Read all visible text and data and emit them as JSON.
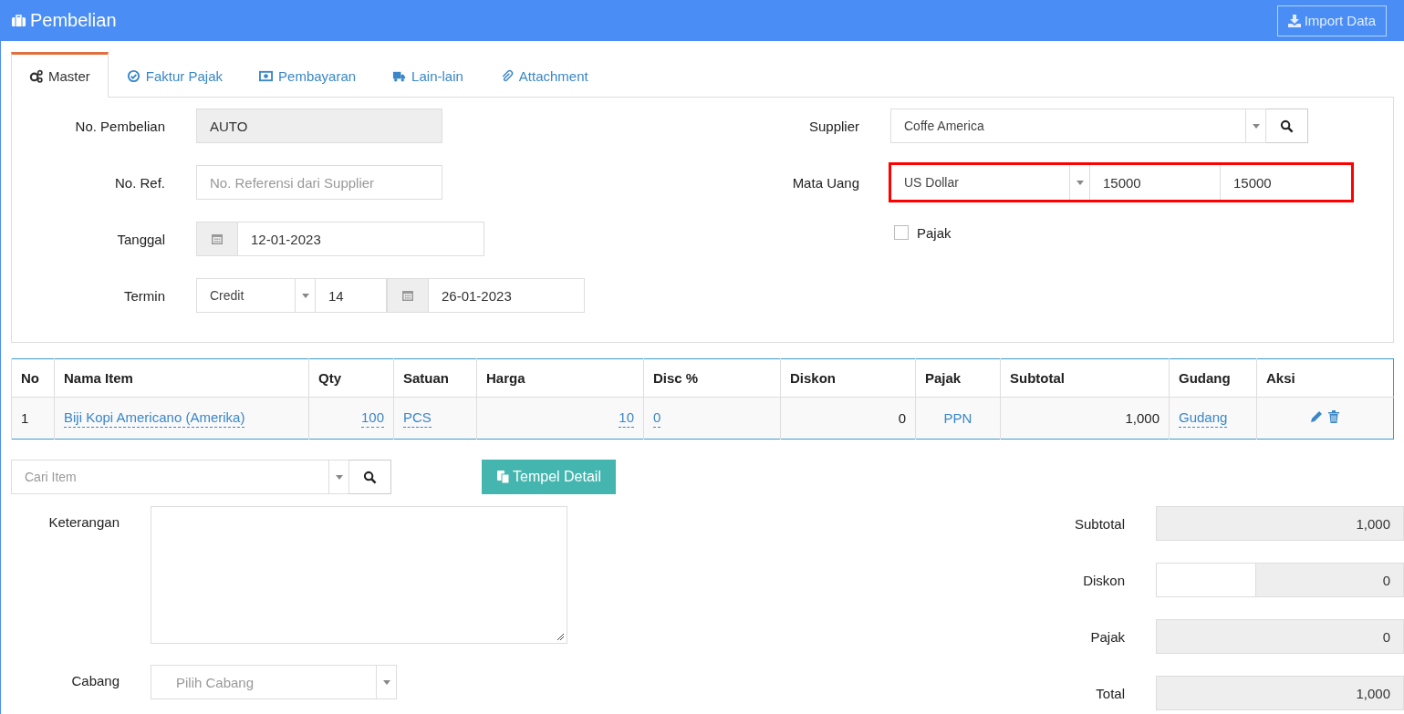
{
  "header": {
    "title": "Pembelian",
    "import_button": "Import Data"
  },
  "tabs": [
    {
      "label": "Master",
      "selected": true
    },
    {
      "label": "Faktur Pajak",
      "selected": false
    },
    {
      "label": "Pembayaran",
      "selected": false
    },
    {
      "label": "Lain-lain",
      "selected": false
    },
    {
      "label": "Attachment",
      "selected": false
    }
  ],
  "left_fields": [
    {
      "kind": "readonly",
      "label": "No. Pembelian",
      "value": "AUTO"
    },
    {
      "kind": "text",
      "label": "No. Ref.",
      "placeholder": "No. Referensi dari Supplier"
    },
    {
      "kind": "date",
      "label": "Tanggal",
      "value": "12-01-2023"
    },
    {
      "kind": "termin",
      "label": "Termin",
      "type": "Credit",
      "days": "14",
      "due_date": "26-01-2023"
    }
  ],
  "right_fields": [
    {
      "kind": "select-search",
      "label": "Supplier",
      "value": "Coffe America"
    },
    {
      "kind": "currency",
      "label": "Mata Uang",
      "value": "US Dollar",
      "rate": "15000",
      "rate_2": "15000",
      "highlighted": true
    },
    {
      "kind": "checkbox",
      "label": "Pajak",
      "checked": false
    }
  ],
  "table": {
    "columns": [
      "No",
      "Nama Item",
      "Qty",
      "Satuan",
      "Harga",
      "Disc %",
      "Diskon",
      "Pajak",
      "Subtotal",
      "Gudang",
      "Aksi"
    ],
    "rows": [
      {
        "cells": [
          {
            "kind": "plain",
            "text": "1"
          },
          {
            "kind": "editable",
            "text": "Biji Kopi Americano (Amerika)"
          },
          {
            "kind": "editable",
            "text": "100"
          },
          {
            "kind": "editable",
            "text": "PCS"
          },
          {
            "kind": "editable",
            "text": "10"
          },
          {
            "kind": "editable",
            "text": "0"
          },
          {
            "kind": "plain",
            "text": "0"
          },
          {
            "kind": "link",
            "text": "PPN"
          },
          {
            "kind": "plain",
            "text": "1,000"
          },
          {
            "kind": "editable",
            "text": "Gudang"
          }
        ]
      }
    ]
  },
  "item_search": {
    "placeholder": "Cari Item"
  },
  "paste_button": "Tempel Detail",
  "notes": {
    "label": "Keterangan"
  },
  "branch": {
    "label": "Cabang",
    "placeholder": "Pilih Cabang"
  },
  "totals": [
    {
      "kind": "readonly",
      "label": "Subtotal",
      "value": "1,000"
    },
    {
      "kind": "split",
      "label": "Diskon",
      "value": "0"
    },
    {
      "kind": "readonly",
      "label": "Pajak",
      "value": "0"
    },
    {
      "kind": "readonly",
      "label": "Total",
      "value": "1,000"
    }
  ]
}
